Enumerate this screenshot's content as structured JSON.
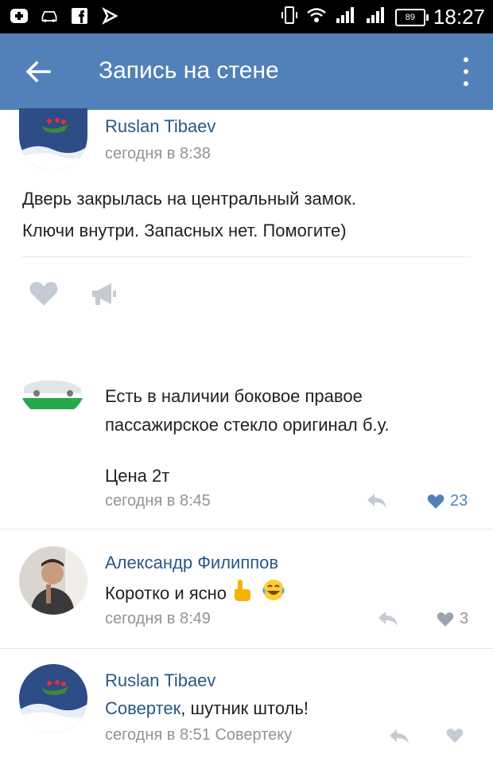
{
  "status_bar": {
    "time": "18:27",
    "battery": "89"
  },
  "header": {
    "title": "Запись на стене"
  },
  "post": {
    "author": "Ruslan Tibaev",
    "time": "сегодня в 8:38",
    "text_line1": "Дверь закрылась на центральный замок.",
    "text_line2": "Ключи внутри. Запасных нет. Помогите)"
  },
  "comments": [
    {
      "author": "",
      "text_line1": "Есть в наличии боковое правое",
      "text_line2": "пассажирское стекло оригинал б.у.",
      "text_line3": "Цена 2т",
      "time": "сегодня в 8:45",
      "likes": "23"
    },
    {
      "author": "Александр Филиппов",
      "text": "Коротко и ясно",
      "time": "сегодня в 8:49",
      "likes": "3"
    },
    {
      "author": "Ruslan Tibaev",
      "mention": "Совертек",
      "text": ", шутник штоль!",
      "time": "сегодня в 8:51",
      "reply_to": "Совертеку"
    }
  ],
  "colors": {
    "header": "#5181b8",
    "link": "#2a5885",
    "muted": "#939393"
  }
}
